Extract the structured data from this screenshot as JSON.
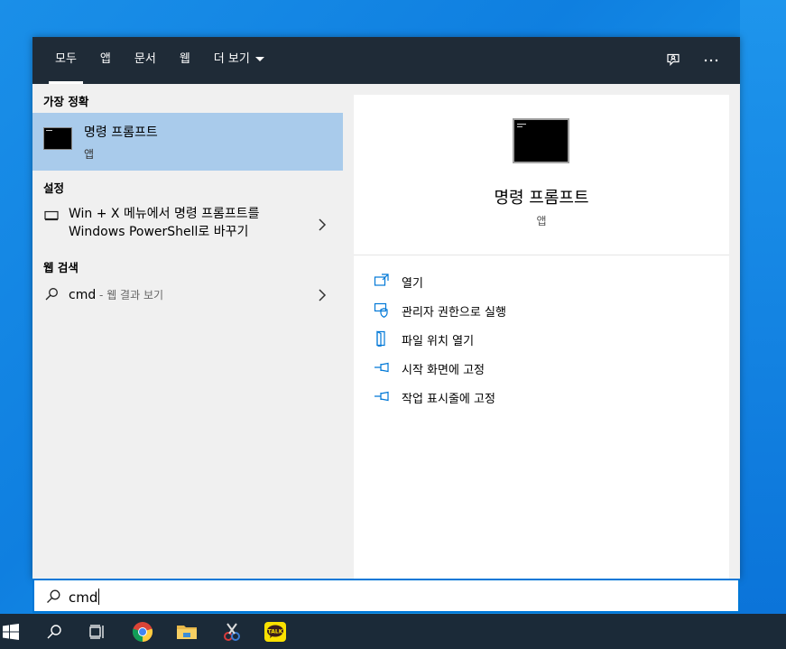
{
  "header": {
    "tabs": [
      {
        "label": "모두"
      },
      {
        "label": "앱"
      },
      {
        "label": "문서"
      },
      {
        "label": "웹"
      },
      {
        "label": "더 보기"
      }
    ]
  },
  "left": {
    "best_match_title": "가장 정확",
    "best_match": {
      "name": "명령 프롬프트",
      "type": "앱"
    },
    "settings_title": "설정",
    "setting_item": {
      "line1": "Win + X 메뉴에서 명령 프롬프트를",
      "line2": "Windows PowerShell로 바꾸기"
    },
    "web_title": "웹 검색",
    "web_item": {
      "query": "cmd",
      "suffix": " - 웹 결과 보기"
    }
  },
  "detail": {
    "name": "명령 프롬프트",
    "type": "앱",
    "actions": [
      {
        "label": "열기",
        "icon": "open-icon"
      },
      {
        "label": "관리자 권한으로 실행",
        "icon": "shield-icon"
      },
      {
        "label": "파일 위치 열기",
        "icon": "file-location-icon"
      },
      {
        "label": "시작 화면에 고정",
        "icon": "pin-icon"
      },
      {
        "label": "작업 표시줄에 고정",
        "icon": "pin-icon"
      }
    ]
  },
  "search": {
    "value": "cmd"
  },
  "taskbar": {
    "items": [
      "windows-start-icon",
      "search-icon",
      "task-view-icon",
      "chrome-icon",
      "file-explorer-icon",
      "snipping-tool-icon",
      "kakaotalk-icon"
    ],
    "kakao_label": "TALK"
  },
  "colors": {
    "accent": "#0078d7",
    "header_bg": "#1f2b37",
    "selection": "#a9cbeb",
    "taskbar": "#1b2a38"
  }
}
